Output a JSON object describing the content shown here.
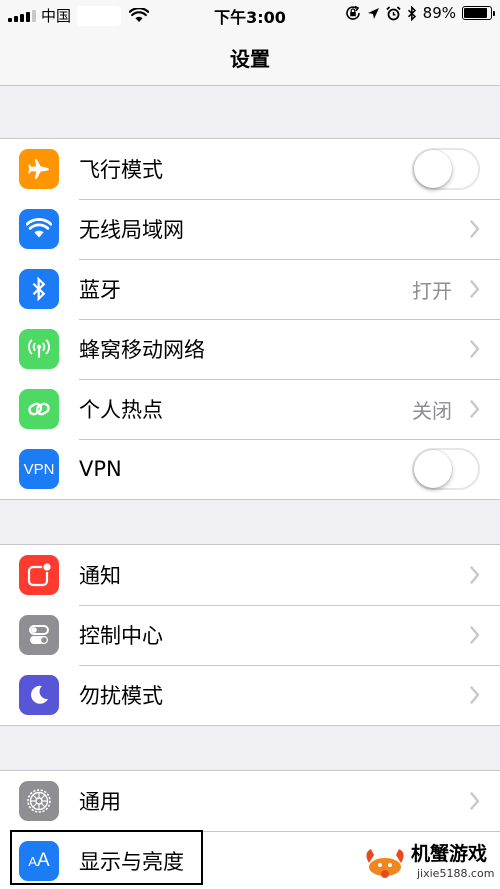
{
  "status_bar": {
    "carrier": "中国",
    "time": "下午3:00",
    "battery_text": "89%",
    "battery_level": 0.89
  },
  "nav": {
    "title": "设置"
  },
  "groups": [
    {
      "items": [
        {
          "label": "飞行模式",
          "icon": "airplane-icon",
          "color": "#ff9500",
          "accessory": "toggle",
          "on": false
        },
        {
          "label": "无线局域网",
          "icon": "wifi-icon",
          "color": "#1b7cf5",
          "accessory": "chevron"
        },
        {
          "label": "蓝牙",
          "icon": "bluetooth-icon",
          "color": "#1b7cf5",
          "value": "打开",
          "accessory": "chevron"
        },
        {
          "label": "蜂窝移动网络",
          "icon": "cellular-antenna-icon",
          "color": "#4cd964",
          "accessory": "chevron"
        },
        {
          "label": "个人热点",
          "icon": "hotspot-link-icon",
          "color": "#4cd964",
          "value": "关闭",
          "accessory": "chevron"
        },
        {
          "label": "VPN",
          "icon": "vpn-icon",
          "icon_text": "VPN",
          "color": "#1b7cf5",
          "accessory": "toggle",
          "on": false
        }
      ]
    },
    {
      "items": [
        {
          "label": "通知",
          "icon": "notifications-icon",
          "color": "#ff3b30",
          "accessory": "chevron"
        },
        {
          "label": "控制中心",
          "icon": "control-center-icon",
          "color": "#8e8e93",
          "accessory": "chevron"
        },
        {
          "label": "勿扰模式",
          "icon": "moon-icon",
          "color": "#5856d6",
          "accessory": "chevron"
        }
      ]
    },
    {
      "items": [
        {
          "label": "通用",
          "icon": "gear-icon",
          "color": "#8e8e93",
          "accessory": "chevron"
        },
        {
          "label": "显示与亮度",
          "icon": "display-brightness-icon",
          "icon_text": "AA",
          "color": "#1b7cf5",
          "accessory": "chevron"
        }
      ]
    }
  ],
  "watermark": {
    "title": "机蟹游戏",
    "url": "jixie5188.com"
  }
}
